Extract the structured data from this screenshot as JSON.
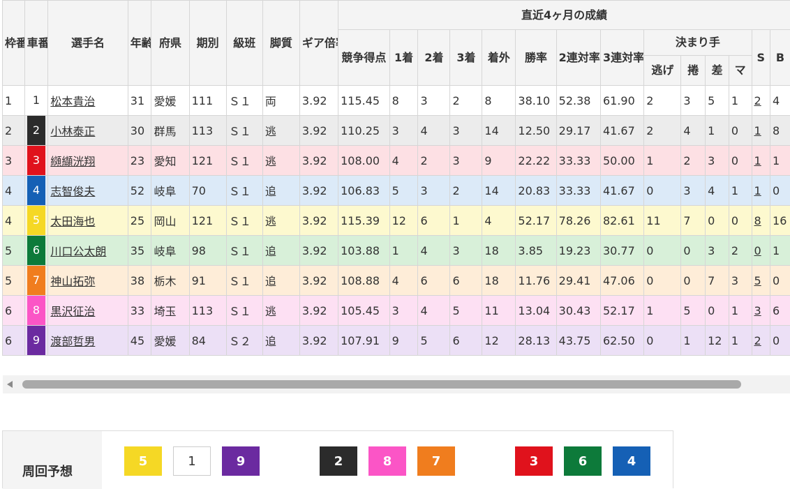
{
  "header": {
    "waku": "枠番",
    "sha": "車番",
    "name": "選手名",
    "age": "年齢",
    "pref": "府県",
    "term": "期別",
    "class": "級班",
    "leg": "脚質",
    "gear": "ギア倍率",
    "recent": "直近4ヶ月の成績",
    "score": "競争得点",
    "first": "1着",
    "second": "2着",
    "third": "3着",
    "out": "着外",
    "win": "勝率",
    "ren2": "2連対率",
    "ren3": "3連対率",
    "kimari": "決まり手",
    "nige": "逃げ",
    "makuri": "捲",
    "sashi": "差",
    "mark": "マ",
    "s": "S",
    "b": "B"
  },
  "riders": [
    {
      "waku": "1",
      "sha": "1",
      "name": "松本貴治",
      "age": "31",
      "pref": "愛媛",
      "term": "111",
      "class": "Ｓ１",
      "leg": "両",
      "gear": "3.92",
      "score": "115.45",
      "first": "8",
      "second": "3",
      "third": "2",
      "out": "8",
      "win": "38.10",
      "ren2": "52.38",
      "ren3": "61.90",
      "nige": "2",
      "makuri": "3",
      "sashi": "5",
      "mark": "1",
      "s": "2",
      "b": "4",
      "bg": "#ffffff",
      "fg": "#333333"
    },
    {
      "waku": "2",
      "sha": "2",
      "name": "小林泰正",
      "age": "30",
      "pref": "群馬",
      "term": "113",
      "class": "Ｓ１",
      "leg": "逃",
      "gear": "3.92",
      "score": "110.25",
      "first": "3",
      "second": "4",
      "third": "3",
      "out": "14",
      "win": "12.50",
      "ren2": "29.17",
      "ren3": "41.67",
      "nige": "2",
      "makuri": "4",
      "sashi": "1",
      "mark": "0",
      "s": "1",
      "b": "8",
      "bg": "#2b2b2b",
      "fg": "#ffffff"
    },
    {
      "waku": "3",
      "sha": "3",
      "name": "纐纈洸翔",
      "age": "23",
      "pref": "愛知",
      "term": "121",
      "class": "Ｓ１",
      "leg": "逃",
      "gear": "3.92",
      "score": "108.00",
      "first": "4",
      "second": "2",
      "third": "3",
      "out": "9",
      "win": "22.22",
      "ren2": "33.33",
      "ren3": "50.00",
      "nige": "1",
      "makuri": "2",
      "sashi": "3",
      "mark": "0",
      "s": "1",
      "b": "1",
      "bg": "#e0121c",
      "fg": "#ffffff"
    },
    {
      "waku": "4",
      "sha": "4",
      "name": "志智俊夫",
      "age": "52",
      "pref": "岐阜",
      "term": "70",
      "class": "Ｓ１",
      "leg": "追",
      "gear": "3.92",
      "score": "106.83",
      "first": "5",
      "second": "3",
      "third": "2",
      "out": "14",
      "win": "20.83",
      "ren2": "33.33",
      "ren3": "41.67",
      "nige": "0",
      "makuri": "3",
      "sashi": "4",
      "mark": "1",
      "s": "1",
      "b": "0",
      "bg": "#1560b5",
      "fg": "#ffffff"
    },
    {
      "waku": "4",
      "sha": "5",
      "name": "太田海也",
      "age": "25",
      "pref": "岡山",
      "term": "121",
      "class": "Ｓ１",
      "leg": "逃",
      "gear": "3.92",
      "score": "115.39",
      "first": "12",
      "second": "6",
      "third": "1",
      "out": "4",
      "win": "52.17",
      "ren2": "78.26",
      "ren3": "82.61",
      "nige": "11",
      "makuri": "7",
      "sashi": "0",
      "mark": "0",
      "s": "8",
      "b": "16",
      "bg": "#f5d825",
      "fg": "#ffffff"
    },
    {
      "waku": "5",
      "sha": "6",
      "name": "川口公太朗",
      "age": "35",
      "pref": "岐阜",
      "term": "98",
      "class": "Ｓ１",
      "leg": "追",
      "gear": "3.92",
      "score": "103.88",
      "first": "1",
      "second": "4",
      "third": "3",
      "out": "18",
      "win": "3.85",
      "ren2": "19.23",
      "ren3": "30.77",
      "nige": "0",
      "makuri": "0",
      "sashi": "3",
      "mark": "2",
      "s": "0",
      "b": "1",
      "bg": "#0d7a3a",
      "fg": "#ffffff"
    },
    {
      "waku": "5",
      "sha": "7",
      "name": "神山拓弥",
      "age": "38",
      "pref": "栃木",
      "term": "91",
      "class": "Ｓ１",
      "leg": "追",
      "gear": "3.92",
      "score": "108.88",
      "first": "4",
      "second": "6",
      "third": "6",
      "out": "18",
      "win": "11.76",
      "ren2": "29.41",
      "ren3": "47.06",
      "nige": "0",
      "makuri": "0",
      "sashi": "7",
      "mark": "3",
      "s": "5",
      "b": "0",
      "bg": "#f07d1e",
      "fg": "#ffffff"
    },
    {
      "waku": "6",
      "sha": "8",
      "name": "黒沢征治",
      "age": "33",
      "pref": "埼玉",
      "term": "113",
      "class": "Ｓ１",
      "leg": "逃",
      "gear": "3.92",
      "score": "105.45",
      "first": "3",
      "second": "4",
      "third": "5",
      "out": "11",
      "win": "13.04",
      "ren2": "30.43",
      "ren3": "52.17",
      "nige": "1",
      "makuri": "5",
      "sashi": "0",
      "mark": "1",
      "s": "3",
      "b": "6",
      "bg": "#fb55c6",
      "fg": "#ffffff"
    },
    {
      "waku": "6",
      "sha": "9",
      "name": "渡部哲男",
      "age": "45",
      "pref": "愛媛",
      "term": "84",
      "class": "Ｓ２",
      "leg": "追",
      "gear": "3.92",
      "score": "107.91",
      "first": "9",
      "second": "5",
      "third": "6",
      "out": "12",
      "win": "28.13",
      "ren2": "43.75",
      "ren3": "62.50",
      "nige": "0",
      "makuri": "1",
      "sashi": "12",
      "mark": "1",
      "s": "2",
      "b": "0",
      "bg": "#6b2aa0",
      "fg": "#ffffff"
    }
  ],
  "forecast": {
    "label": "周回予想",
    "boxes": [
      {
        "num": "5",
        "bg": "#f5d825",
        "fg": "#ffffff",
        "border": "#f5d825"
      },
      {
        "num": "1",
        "bg": "#ffffff",
        "fg": "#333333",
        "border": "#cccccc"
      },
      {
        "num": "9",
        "bg": "#6b2aa0",
        "fg": "#ffffff",
        "border": "#6b2aa0"
      },
      {
        "num": "2",
        "bg": "#2b2b2b",
        "fg": "#ffffff",
        "border": "#2b2b2b"
      },
      {
        "num": "8",
        "bg": "#fb55c6",
        "fg": "#ffffff",
        "border": "#fb55c6"
      },
      {
        "num": "7",
        "bg": "#f07d1e",
        "fg": "#ffffff",
        "border": "#f07d1e"
      },
      {
        "num": "3",
        "bg": "#e0121c",
        "fg": "#ffffff",
        "border": "#e0121c"
      },
      {
        "num": "6",
        "bg": "#0d7a3a",
        "fg": "#ffffff",
        "border": "#0d7a3a"
      },
      {
        "num": "4",
        "bg": "#1560b5",
        "fg": "#ffffff",
        "border": "#1560b5"
      }
    ]
  }
}
